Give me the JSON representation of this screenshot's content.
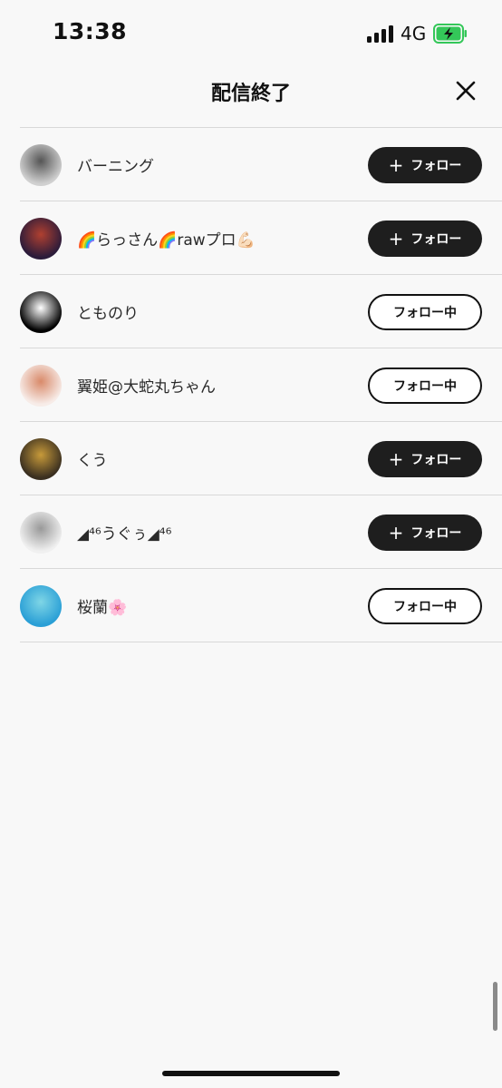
{
  "status_bar": {
    "time": "13:38",
    "network": "4G",
    "battery_icon": "battery-charging-icon",
    "signal_icon": "signal-bars-icon"
  },
  "header": {
    "title": "配信終了",
    "close_icon": "close-icon"
  },
  "labels": {
    "follow": "フォロー",
    "following": "フォロー中"
  },
  "users": [
    {
      "name": "バーニング",
      "following": false,
      "avatar_colors": [
        "#d0d0d0",
        "#555"
      ]
    },
    {
      "name": "🌈らっさん🌈rawプロ💪🏻",
      "following": false,
      "avatar_colors": [
        "#2b1b3a",
        "#b04030"
      ]
    },
    {
      "name": "とものり",
      "following": true,
      "avatar_colors": [
        "#000000",
        "#ffffff"
      ]
    },
    {
      "name": "翼姫@大蛇丸ちゃん",
      "following": true,
      "avatar_colors": [
        "#f7ece8",
        "#d98a6a"
      ]
    },
    {
      "name": "くう",
      "following": false,
      "avatar_colors": [
        "#3a2f20",
        "#c79a3a"
      ]
    },
    {
      "name": "◢⁴⁶うぐぅ◢⁴⁶",
      "following": false,
      "avatar_colors": [
        "#f0f0f0",
        "#999"
      ]
    },
    {
      "name": "桜蘭🌸",
      "following": true,
      "avatar_colors": [
        "#2a9fd6",
        "#7fd6e6"
      ]
    }
  ],
  "accent": "#1e1e1e",
  "battery_color": "#34c759"
}
